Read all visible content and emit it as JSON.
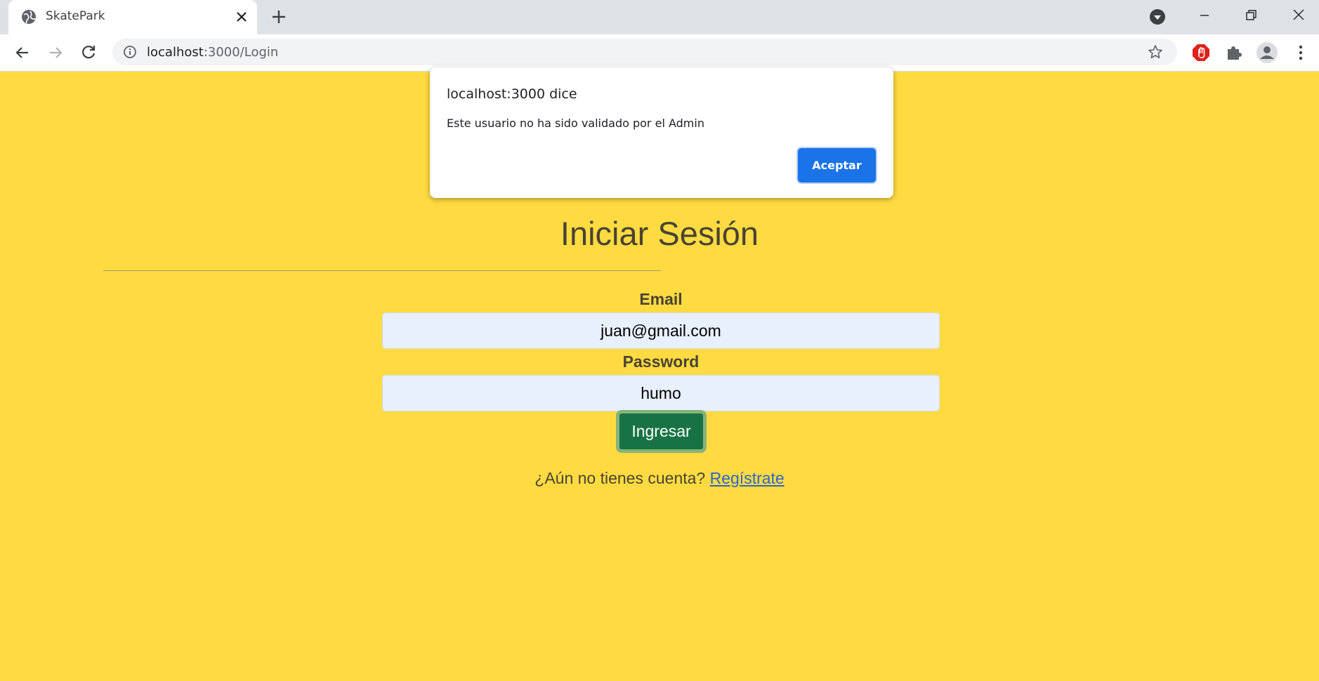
{
  "browser": {
    "tab_title": "SkatePark",
    "url_host": "localhost",
    "url_rest": ":3000/Login"
  },
  "page": {
    "title": "Iniciar Sesión",
    "email_label": "Email",
    "email_value": "juan@gmail.com",
    "password_label": "Password",
    "password_value": "humo",
    "submit_label": "Ingresar",
    "register_prompt": "¿Aún no tienes cuenta?",
    "register_link": "Regístrate"
  },
  "dialog": {
    "title": "localhost:3000 dice",
    "message": "Este usuario no ha sido validado por el Admin",
    "ok_label": "Aceptar"
  },
  "colors": {
    "page_background": "#ffdb41",
    "submit_button": "#177344",
    "dialog_button": "#1a73e8",
    "link": "#2f64c9"
  },
  "icons": [
    "globe-icon",
    "close-icon",
    "plus-icon",
    "tab-search-icon",
    "minimize-icon",
    "restore-icon",
    "window-close-icon",
    "back-arrow-icon",
    "forward-arrow-icon",
    "reload-icon",
    "info-icon",
    "star-icon",
    "adblock-icon",
    "puzzle-icon",
    "profile-icon",
    "kebab-menu-icon"
  ]
}
